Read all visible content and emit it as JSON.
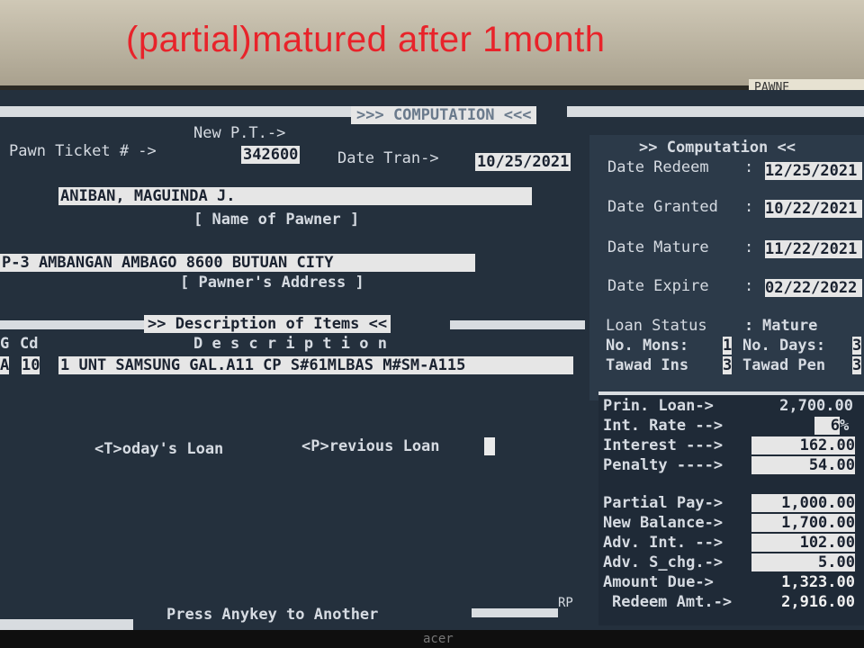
{
  "caption": "(partial)matured after 1month",
  "sticker_text": "PAWNE\nZBAG",
  "bezel_brand": "acer",
  "screen": {
    "header": ">>> COMPUTATION <<<",
    "new_pt": "New P.T.->",
    "pawn_ticket_label": "Pawn Ticket # ->",
    "pawn_ticket_value": "342600",
    "date_tran_label": "Date Tran->",
    "date_tran_value": "10/25/2021",
    "pawner_name": "ANIBAN, MAGUINDA J.",
    "name_caption": "[ Name of Pawner ]",
    "pawner_address": "P-3 AMBANGAN AMBAGO 8600 BUTUAN CITY",
    "address_caption": "[ Pawner's Address ]",
    "items_header": ">> Description of Items <<",
    "col_g": "G",
    "col_cd": "Cd",
    "col_desc": "D e s c r i p t i o n",
    "item_g": "A",
    "item_cd": "10",
    "item_desc": "1 UNT SAMSUNG GAL.A11 CP S#61MLBAS M#SM-A115",
    "todays_loan": "<T>oday's Loan",
    "previous_loan": "<P>revious Loan",
    "footer": "Press Anykey to Another",
    "rp": "RP",
    "right": {
      "header": ">> Computation <<",
      "date_redeem_label": "Date Redeem",
      "date_redeem_value": "12/25/2021",
      "date_granted_label": "Date Granted",
      "date_granted_value": "10/22/2021",
      "date_mature_label": "Date Mature",
      "date_mature_value": "11/22/2021",
      "date_expire_label": "Date Expire",
      "date_expire_value": "02/22/2022",
      "loan_status_label": "Loan Status",
      "loan_status_value": "Mature",
      "no_mons_label": "No. Mons:",
      "no_mons_value": "1",
      "no_days_label": "No. Days:",
      "no_days_value": "3",
      "tawad_ins_label": "Tawad Ins",
      "tawad_ins_value": "3",
      "tawad_pen_label": "Tawad Pen",
      "tawad_pen_value": "3"
    },
    "calc": {
      "prin_loan_label": "Prin. Loan->",
      "prin_loan_value": "2,700.00",
      "int_rate_label": "Int. Rate -->",
      "int_rate_value": "6",
      "int_rate_unit": "%",
      "interest_label": "Interest --->",
      "interest_value": "162.00",
      "penalty_label": "Penalty ---->",
      "penalty_value": "54.00",
      "partial_pay_label": "Partial Pay->",
      "partial_pay_value": "1,000.00",
      "new_balance_label": "New Balance->",
      "new_balance_value": "1,700.00",
      "adv_int_label": "Adv. Int. -->",
      "adv_int_value": "102.00",
      "adv_schg_label": "Adv. S_chg.->",
      "adv_schg_value": "5.00",
      "amount_due_label": "Amount Due->",
      "amount_due_value": "1,323.00",
      "redeem_amt_label": "Redeem Amt.->",
      "redeem_amt_value": "2,916.00"
    }
  }
}
